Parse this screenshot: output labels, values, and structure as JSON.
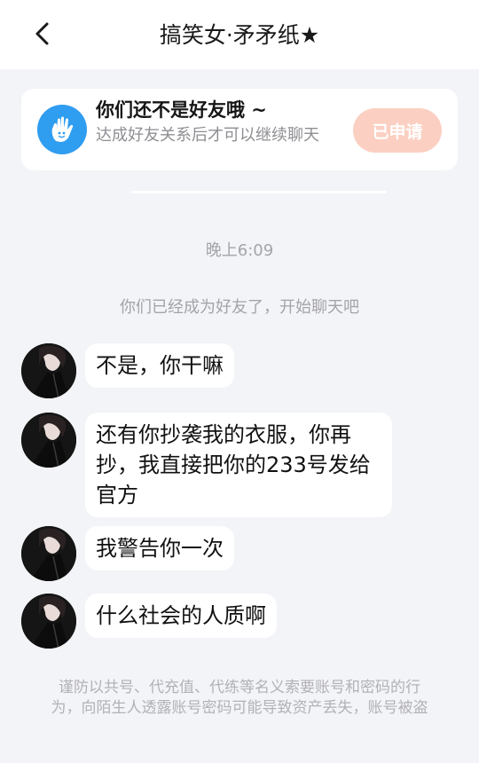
{
  "header": {
    "title": "搞笑女·矛矛纸★",
    "back_icon": "chevron-left-icon"
  },
  "friend_notice": {
    "icon": "hand-wave-icon",
    "title": "你们还不是好友哦 ~",
    "subtitle": "达成好友关系后才可以继续聊天",
    "button_label": "已申请",
    "accent_color": "#2f9df0",
    "button_color": "#fbd0c2"
  },
  "chat": {
    "timestamp": "晚上6:09",
    "system_message": "你们已经成为好友了，开始聊天吧",
    "messages": [
      {
        "text": "不是，你干嘛"
      },
      {
        "text": "还有你抄袭我的衣服，你再抄，我直接把你的233号发给官方"
      },
      {
        "text": "我警告你一次"
      },
      {
        "text": "什么社会的人质啊"
      }
    ]
  },
  "footer": {
    "warning": "谨防以共号、代充值、代练等名义索要账号和密码的行为，向陌生人透露账号密码可能导致资产丢失，账号被盗"
  }
}
